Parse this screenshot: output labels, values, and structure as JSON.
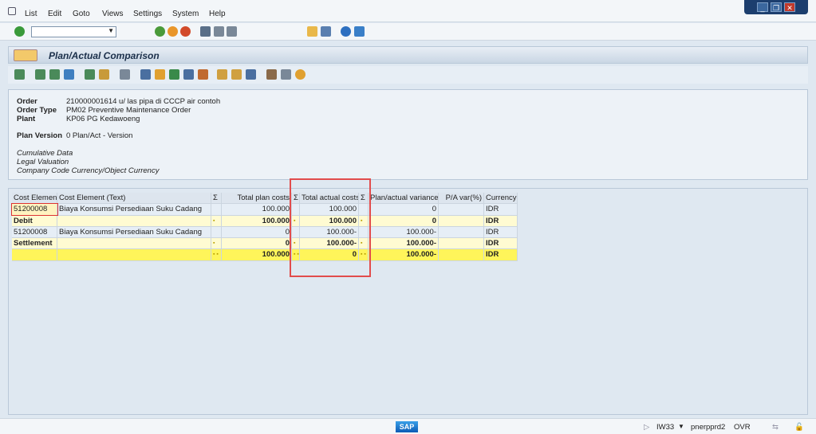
{
  "menu": [
    "List",
    "Edit",
    "Goto",
    "Views",
    "Settings",
    "System",
    "Help"
  ],
  "title": "Plan/Actual Comparison",
  "header": {
    "fields": [
      {
        "label": "Order",
        "value": "210000001614 u/ las pipa di CCCP air contoh"
      },
      {
        "label": "Order Type",
        "value": "PM02 Preventive Maintenance Order"
      },
      {
        "label": "Plant",
        "value": "KP06 PG Kedawoeng"
      }
    ],
    "plan_version_label": "Plan Version",
    "plan_version": "0 Plan/Act - Version",
    "notes": [
      "Cumulative Data",
      "Legal Valuation",
      "Company Code Currency/Object Currency"
    ]
  },
  "grid": {
    "columns": [
      "Cost Element",
      "Cost Element (Text)",
      "Σ",
      "Total plan costs",
      "Σ",
      "Total actual costs",
      "Σ",
      "Plan/actual variance",
      "P/A var(%)",
      "Currency"
    ],
    "rows": [
      {
        "type": "n",
        "cells": [
          "51200008",
          "Biaya Konsumsi Persediaan Suku Cadang",
          "",
          "100.000",
          "",
          "100.000",
          "",
          "0",
          "",
          "IDR"
        ]
      },
      {
        "type": "sub",
        "cells": [
          "Debit",
          "",
          "▪",
          "100.000",
          "▪",
          "100.000",
          "▪",
          "0",
          "",
          "IDR"
        ]
      },
      {
        "type": "n",
        "cells": [
          "51200008",
          "Biaya Konsumsi Persediaan Suku Cadang",
          "",
          "0",
          "",
          "100.000-",
          "",
          "100.000-",
          "",
          "IDR"
        ]
      },
      {
        "type": "sub",
        "cells": [
          "Settlement",
          "",
          "▪",
          "0",
          "▪",
          "100.000-",
          "▪",
          "100.000-",
          "",
          "IDR"
        ]
      },
      {
        "type": "tot",
        "cells": [
          "",
          "",
          "▪ ▪",
          "100.000",
          "▪ ▪",
          "0",
          "▪ ▪",
          "100.000-",
          "",
          "IDR"
        ]
      }
    ]
  },
  "status": {
    "tcode": "IW33",
    "server": "pnerpprd2",
    "mode": "OVR",
    "logo": "SAP"
  }
}
